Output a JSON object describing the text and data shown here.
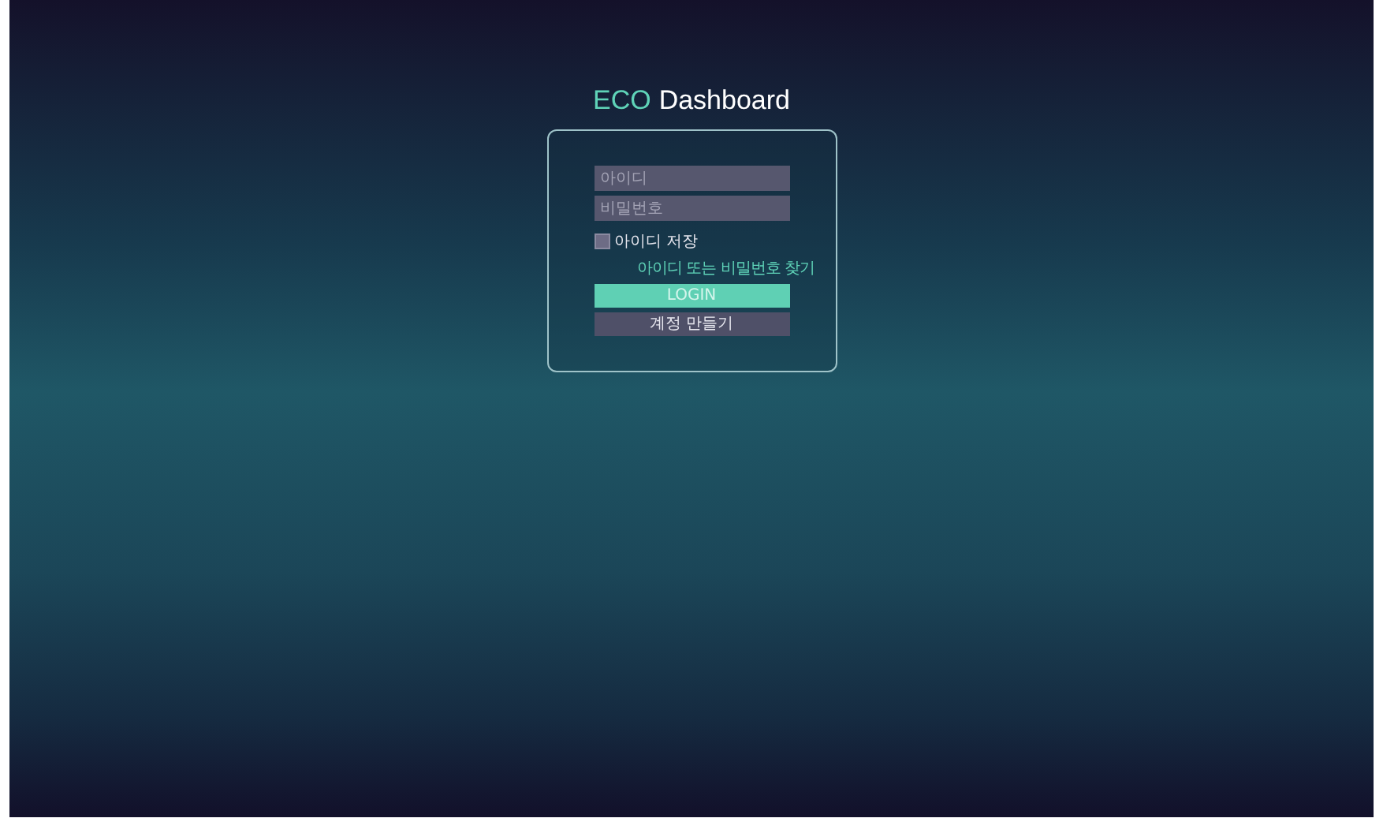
{
  "title": {
    "accent": "ECO",
    "rest": "Dashboard"
  },
  "login_form": {
    "id_field": {
      "placeholder": "아이디"
    },
    "password_field": {
      "placeholder": "비밀번호"
    },
    "remember": {
      "label": "아이디 저장",
      "checked": false
    },
    "find_link": "아이디 또는 비밀번호 찾기",
    "login_button": "LOGIN",
    "signup_button": "계정 만들기"
  }
}
